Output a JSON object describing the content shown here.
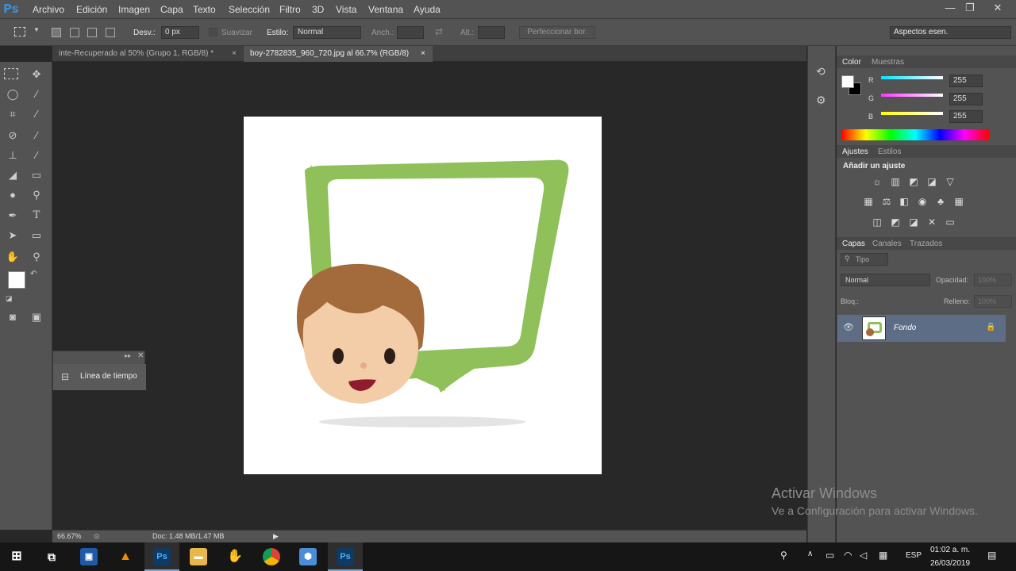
{
  "app": {
    "logo": "Ps"
  },
  "menu": [
    "Archivo",
    "Edición",
    "Imagen",
    "Capa",
    "Texto",
    "Selección",
    "Filtro",
    "3D",
    "Vista",
    "Ventana",
    "Ayuda"
  ],
  "window_controls": {
    "minimize": "—",
    "restore": "❐",
    "close": "✕"
  },
  "options": {
    "desv_label": "Desv.:",
    "desv_value": "0 px",
    "suavizar_label": "Suavizar",
    "estilo_label": "Estilo:",
    "estilo_value": "Normal",
    "anch_label": "Anch.:",
    "alt_label": "Alt.:",
    "refine_button": "Perfeccionar bor.",
    "workspace": "Aspectos esen."
  },
  "tabs": [
    {
      "label": "inte-Recuperado al 50% (Grupo 1, RGB/8) *",
      "close": "×"
    },
    {
      "label": "boy-2782835_960_720.jpg al 66.7% (RGB/8)",
      "close": "×"
    }
  ],
  "timeline_panel": {
    "label": "Línea de tiempo"
  },
  "status": {
    "zoom": "66.67%",
    "doc": "Doc: 1.48 MB/1.47 MB"
  },
  "color_panel": {
    "tabs": [
      "Color",
      "Muestras"
    ],
    "channels": [
      {
        "name": "R",
        "value": "255",
        "color": "#00e5ff"
      },
      {
        "name": "G",
        "value": "255",
        "color": "#ff33ff"
      },
      {
        "name": "B",
        "value": "255",
        "color": "#ffff00"
      }
    ]
  },
  "adjustments_panel": {
    "tabs": [
      "Ajustes",
      "Estilos"
    ],
    "heading": "Añadir un ajuste"
  },
  "layers_panel": {
    "tabs": [
      "Capas",
      "Canales",
      "Trazados"
    ],
    "filter": "Tipo",
    "blend_mode": "Normal",
    "opacity_label": "Opacidad:",
    "opacity_value": "100%",
    "lock_label": "Bloq.:",
    "fill_label": "Relleno:",
    "fill_value": "100%",
    "layers": [
      {
        "name": "Fondo"
      }
    ]
  },
  "watermark": {
    "line1": "Activar Windows",
    "line2": "Ve a Configuración para activar Windows."
  },
  "taskbar": {
    "lang": "ESP",
    "time": "01:02 a. m.",
    "date": "26/03/2019"
  },
  "icons": [
    "marquee-icon",
    "move-icon",
    "lasso-icon",
    "magic-wand-icon",
    "crop-icon",
    "eyedropper-icon",
    "healing-icon",
    "brush-icon",
    "stamp-icon",
    "history-brush-icon",
    "eraser-icon",
    "gradient-icon",
    "blur-icon",
    "dodge-icon",
    "pen-icon",
    "type-icon",
    "path-select-icon",
    "shape-icon",
    "hand-icon",
    "zoom-icon"
  ]
}
